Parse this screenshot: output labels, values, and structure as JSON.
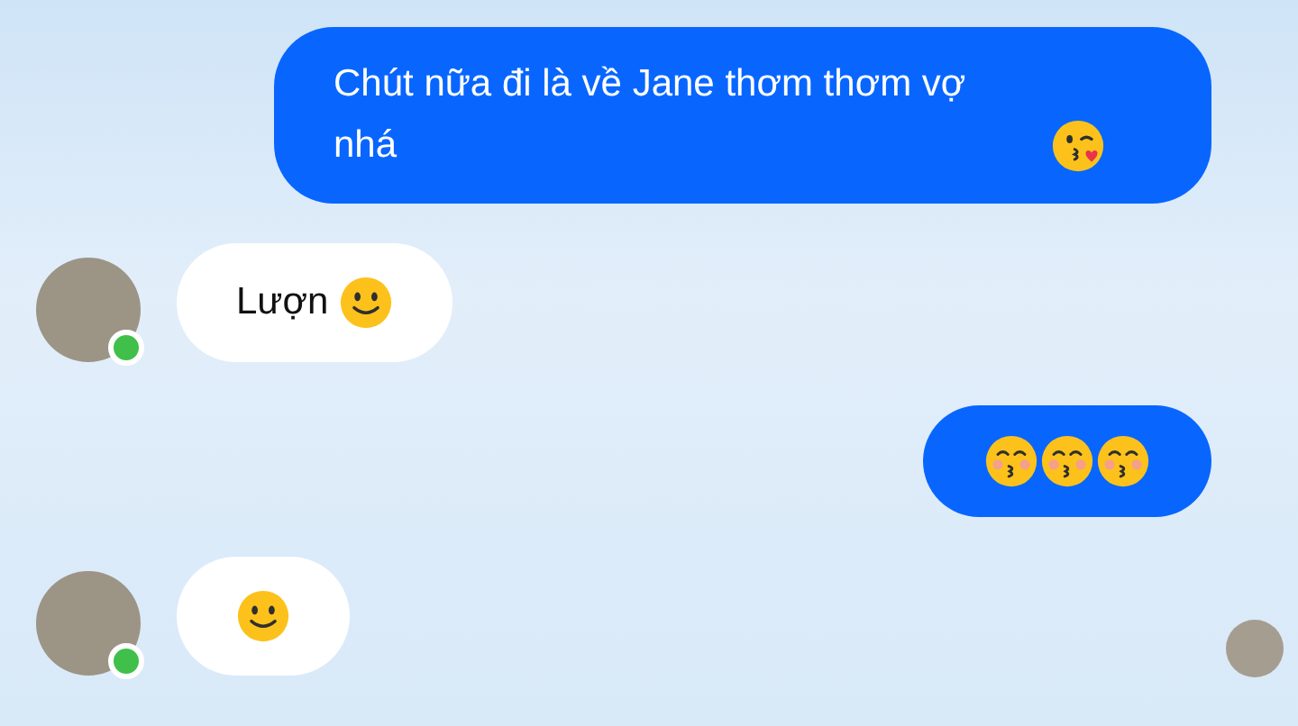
{
  "messages": [
    {
      "kind": "sent",
      "text": "Chút nữa đi là về Jane thơm thơm vợ nhá",
      "emoji": [
        {
          "kind": "kiss-heart"
        }
      ]
    },
    {
      "kind": "received",
      "text": "Lượn",
      "emoji": [
        {
          "kind": "smile"
        }
      ],
      "online": true
    },
    {
      "kind": "sent",
      "emoji": [
        {
          "kind": "kiss-closed"
        },
        {
          "kind": "kiss-closed"
        },
        {
          "kind": "kiss-closed"
        }
      ]
    },
    {
      "kind": "received",
      "emoji": [
        {
          "kind": "smile"
        }
      ],
      "online": true
    }
  ],
  "read_receipt": true
}
